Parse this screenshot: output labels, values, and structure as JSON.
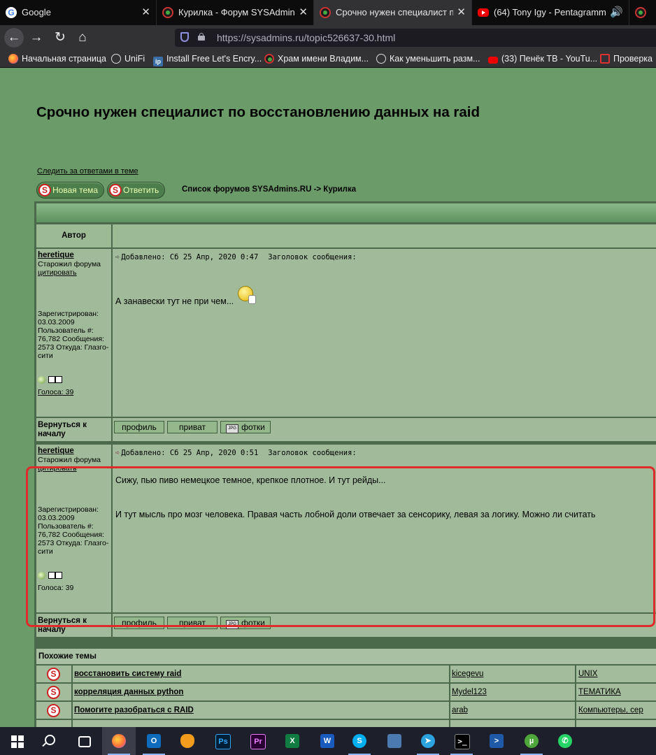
{
  "tabs": [
    {
      "title": "Google",
      "favicon": "google-icon"
    },
    {
      "title": "Курилка - Форум SYSAdmins.RU",
      "favicon": "sysadmins-icon"
    },
    {
      "title": "Срочно нужен специалист по восстановлению данных на raid",
      "favicon": "sysadmins-icon",
      "active": true
    },
    {
      "title": "(64) Tony Igy - Pentagramm",
      "favicon": "youtube-icon"
    }
  ],
  "url": "https://sysadmins.ru/topic526637-30.html",
  "bookmarks": [
    "Начальная страница",
    "UniFi",
    "Install Free Let's Encry...",
    "Храм имени Владим...",
    "Как уменьшить разм...",
    "(33) Пенёк ТВ - YouTu...",
    "Проверка"
  ],
  "page": {
    "title": "Срочно нужен специалист по восстановлению данных на raid",
    "watch_link": "Следить за ответами в теме",
    "new_topic_button": "Новая тема",
    "reply_button": "Ответить",
    "breadcrumb": "Список форумов SYSAdmins.RU -> Курилка",
    "author_header": "Автор"
  },
  "posts": [
    {
      "username": "heretique",
      "rank": "Старожил форума",
      "quote": "цитировать",
      "stats": "Зарегистрирован: 03.03.2009 Пользователь #: 76,782 Сообщения: 2573 Откуда: Глазго-сити",
      "votes": "Голоса: 39",
      "added": "Добавлено: Сб 25 Апр, 2020 0:47",
      "subject_label": "Заголовок сообщения:",
      "body": "А занавески тут не при чем...",
      "body2": ""
    },
    {
      "username": "heretique",
      "rank": "Старожил форума",
      "quote": "цитировать",
      "stats": "Зарегистрирован: 03.03.2009 Пользователь #: 76,782 Сообщения: 2573 Откуда: Глазго-сити",
      "votes": "Голоса: 39",
      "added": "Добавлено: Сб 25 Апр, 2020 0:51",
      "subject_label": "Заголовок сообщения:",
      "body": "Сижу, пью пиво немецкое темное, крепкое плотное. И тут рейды...",
      "body2": "И тут мысль про мозг человека. Правая часть лобной доли отвечает за сенсорику, левая за логику. Можно ли считать"
    }
  ],
  "post_footer": {
    "back_to_top": "Вернуться к началу",
    "profile_button": "профиль",
    "private_button": "приват",
    "photos_button": "фотки"
  },
  "similar": {
    "title": "Похожие темы",
    "rows": [
      {
        "topic": "восстановить систему raid",
        "author": "kicegevu",
        "forum": "UNIX"
      },
      {
        "topic": "корреляция данных python",
        "author": "Mydel123",
        "forum": "ТЕМАТИКА"
      },
      {
        "topic": "Помогите разобраться с RAID",
        "author": "arab",
        "forum": "Компьютеры, сер"
      }
    ]
  },
  "colors": {
    "page_bg": "#6b9b68",
    "cell_bg": "#a1bb9a",
    "highlight_border": "#e02b2b"
  }
}
